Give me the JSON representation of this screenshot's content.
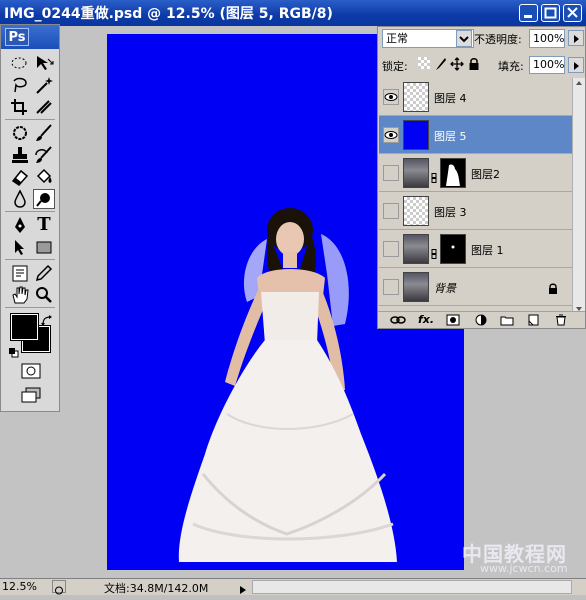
{
  "window": {
    "title": "IMG_0244重做.psd @ 12.5% (图层 5, RGB/8)"
  },
  "toolbox": {
    "logo": "Ps",
    "tool_a_label": "A",
    "tool_t_label": "T"
  },
  "layers_panel": {
    "blend_mode": "正常",
    "opacity_label": "不透明度:",
    "opacity_value": "100%",
    "lock_label": "锁定:",
    "fill_label": "填充:",
    "fill_value": "100%",
    "layers": [
      {
        "name": "图层 4",
        "visible": true,
        "selected": false,
        "thumb": "checker",
        "has_mask": false
      },
      {
        "name": "图层 5",
        "visible": true,
        "selected": true,
        "thumb": "blue",
        "has_mask": false
      },
      {
        "name": "图层2",
        "visible": false,
        "selected": false,
        "thumb": "photo",
        "has_mask": true
      },
      {
        "name": "图层 3",
        "visible": false,
        "selected": false,
        "thumb": "checker",
        "has_mask": false
      },
      {
        "name": "图层 1",
        "visible": false,
        "selected": false,
        "thumb": "photo",
        "has_mask": true
      },
      {
        "name": "背景",
        "visible": false,
        "selected": false,
        "thumb": "photo",
        "has_mask": false,
        "locked": true
      }
    ],
    "footer_fx": "fx."
  },
  "status": {
    "zoom": "12.5%",
    "doc_info": "文档:34.8M/142.0M"
  },
  "watermark": {
    "main": "中国教程网",
    "url": "www.jcwcn.com"
  },
  "colors": {
    "canvas_blue": "#0000f5",
    "selected_layer": "#5e87c7",
    "titlebar": "#0c3aa8"
  }
}
